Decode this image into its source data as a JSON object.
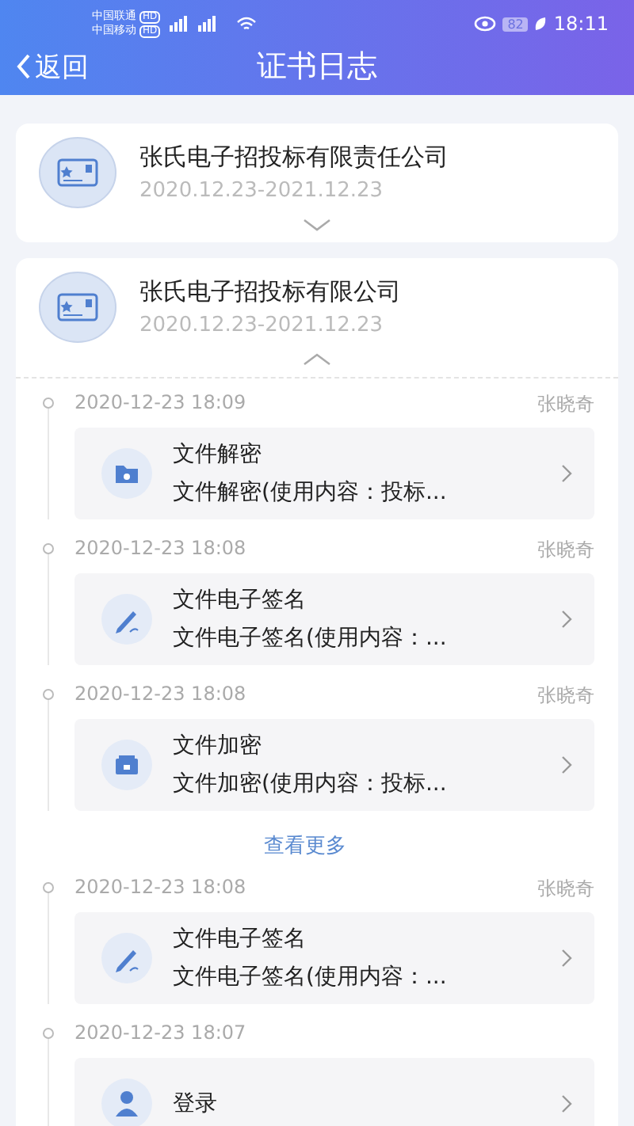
{
  "status_bar": {
    "carriers": [
      {
        "name": "中国联通",
        "badge": "HD"
      },
      {
        "name": "中国移动",
        "badge": "HD"
      }
    ],
    "battery": "82",
    "time": "18:11"
  },
  "nav": {
    "back": "返回",
    "title": "证书日志"
  },
  "certificates": [
    {
      "name": "张氏电子招投标有限责任公司",
      "validity": "2020.12.23-2021.12.23",
      "expanded": false
    },
    {
      "name": "张氏电子招投标有限公司",
      "validity": "2020.12.23-2021.12.23",
      "expanded": true,
      "logs": [
        {
          "time": "2020-12-23 18:09",
          "user": "张晓奇",
          "kind": "decrypt",
          "title": "文件解密",
          "detail": "文件解密(使用内容：投标..."
        },
        {
          "time": "2020-12-23 18:08",
          "user": "张晓奇",
          "kind": "sign",
          "title": "文件电子签名",
          "detail": "文件电子签名(使用内容：..."
        },
        {
          "time": "2020-12-23 18:08",
          "user": "张晓奇",
          "kind": "encrypt",
          "title": "文件加密",
          "detail": "文件加密(使用内容：投标..."
        }
      ],
      "more_link": "查看更多",
      "later_logs": [
        {
          "time": "2020-12-23 18:08",
          "user": "张晓奇",
          "kind": "sign",
          "title": "文件电子签名",
          "detail": "文件电子签名(使用内容：..."
        },
        {
          "time": "2020-12-23 18:07",
          "kind": "login",
          "title": "登录"
        }
      ]
    }
  ]
}
